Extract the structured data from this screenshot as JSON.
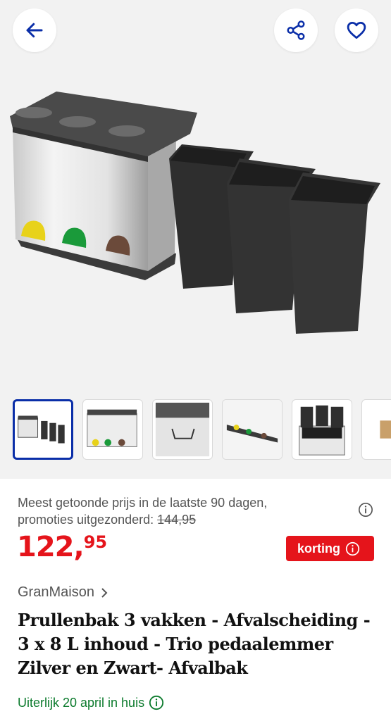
{
  "header": {
    "back_icon": "arrow-left-icon",
    "share_icon": "share-icon",
    "favorite_icon": "heart-icon",
    "accent": "#0a2ea8"
  },
  "gallery": {
    "thumbnail_count_visible": 6,
    "selected_index": 0
  },
  "pricing": {
    "note_line1": "Meest getoonde prijs in de laatste 90 dagen,",
    "note_line2": "promoties uitgezonderd: ",
    "old_price": "144,95",
    "price_main": "122,",
    "price_cents": "95",
    "badge_label": "korting",
    "price_color": "#e5141b"
  },
  "product": {
    "brand": "GranMaison",
    "title": "Prullenbak 3 vakken - Afvalscheiding - 3 x 8 L inhoud - Trio pedaalemmer Zilver en Zwart- Afvalbak",
    "delivery": "Uiterlijk 20 april in huis",
    "delivery_color": "#0b7a2c"
  }
}
